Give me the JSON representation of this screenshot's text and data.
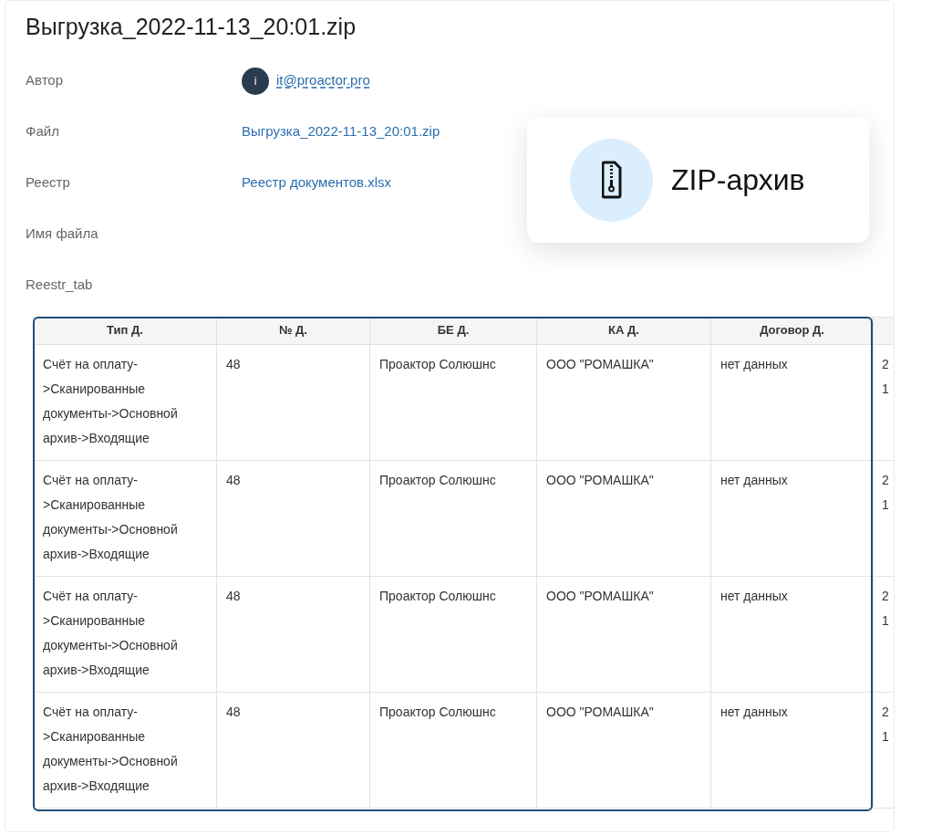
{
  "title": "Выгрузка_2022-11-13_20:01.zip",
  "fields": [
    {
      "label": "Автор",
      "value": "it@proactor.pro",
      "kind": "user"
    },
    {
      "label": "Файл",
      "value": "Выгрузка_2022-11-13_20:01.zip",
      "kind": "link"
    },
    {
      "label": "Реестр",
      "value": "Реестр документов.xlsx",
      "kind": "link"
    },
    {
      "label": "Имя файла",
      "kind": "empty"
    },
    {
      "label": "Reestr_tab",
      "kind": "empty"
    }
  ],
  "avatar": {
    "letter": "i"
  },
  "file_type": {
    "label": "ZIP-архив"
  },
  "table": {
    "columns": [
      "Тип Д.",
      "№ Д.",
      "БЕ Д.",
      "КА Д.",
      "Договор Д.",
      ""
    ],
    "rows": [
      {
        "cells": [
          "Счёт на оплату->Сканированные документы->Основной архив->Входящие",
          "48",
          "Проактор Солюшнс",
          "ООО \"РОМАШКА\"",
          "нет данных",
          "2 1"
        ]
      },
      {
        "cells": [
          "Счёт на оплату->Сканированные документы->Основной архив->Входящие",
          "48",
          "Проактор Солюшнс",
          "ООО \"РОМАШКА\"",
          "нет данных",
          "2 1"
        ]
      },
      {
        "cells": [
          "Счёт на оплату->Сканированные документы->Основной архив->Входящие",
          "48",
          "Проактор Солюшнс",
          "ООО \"РОМАШКА\"",
          "нет данных",
          "2 1"
        ]
      },
      {
        "cells": [
          "Счёт на оплату->Сканированные документы->Основной архив->Входящие",
          "48",
          "Проактор Солюшнс",
          "ООО \"РОМАШКА\"",
          "нет данных",
          "2 1"
        ]
      }
    ]
  }
}
